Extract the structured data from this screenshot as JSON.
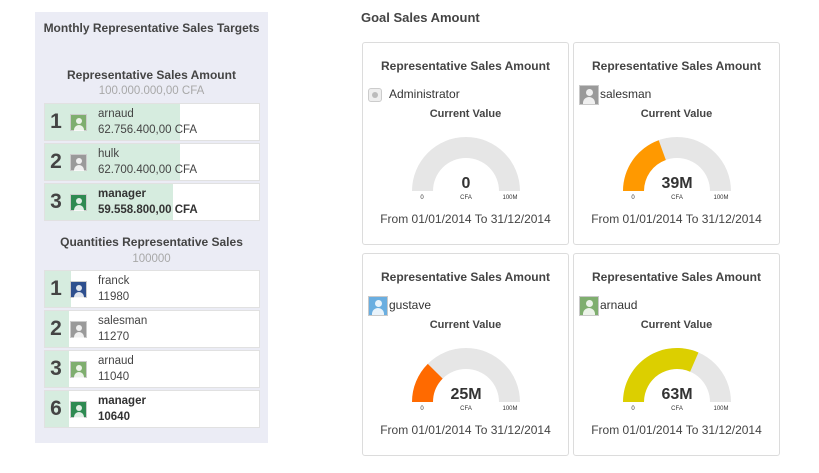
{
  "left_panel": {
    "title": "Monthly Representative Sales Targets",
    "amount_section": {
      "title": "Representative Sales Amount",
      "target": "100.000.000,00 CFA",
      "rows": [
        {
          "rank": "1",
          "name": "arnaud",
          "value": "62.756.400,00 CFA",
          "progress": 0.63,
          "avatar_color": "#7fae6f",
          "bold": false
        },
        {
          "rank": "2",
          "name": "hulk",
          "value": "62.700.400,00 CFA",
          "progress": 0.63,
          "avatar_color": "#9a9a9a",
          "bold": false
        },
        {
          "rank": "3",
          "name": "manager",
          "value": "59.558.800,00 CFA",
          "progress": 0.6,
          "avatar_color": "#2f8a52",
          "bold": true
        }
      ]
    },
    "quantity_section": {
      "title": "Quantities Representative Sales",
      "target": "100000",
      "rows": [
        {
          "rank": "1",
          "name": "franck",
          "value": "11980",
          "progress": 0.12,
          "avatar_color": "#2e4f8e",
          "bold": false
        },
        {
          "rank": "2",
          "name": "salesman",
          "value": "11270",
          "progress": 0.11,
          "avatar_color": "#9a9a9a",
          "bold": false
        },
        {
          "rank": "3",
          "name": "arnaud",
          "value": "11040",
          "progress": 0.11,
          "avatar_color": "#7fae6f",
          "bold": false
        },
        {
          "rank": "6",
          "name": "manager",
          "value": "10640",
          "progress": 0.11,
          "avatar_color": "#2f8a52",
          "bold": true
        }
      ]
    }
  },
  "goal": {
    "title": "Goal Sales Amount",
    "cards": [
      {
        "title": "Representative Sales Amount",
        "user": "Administrator",
        "user_icon": "admin-icon",
        "avatar_color": "#eeeeee",
        "current_label": "Current Value",
        "value_text": "0",
        "fraction": 0.0,
        "fill_color": "#ff9900",
        "min_label": "0",
        "max_label": "100M",
        "unit": "CFA",
        "range": "From 01/01/2014 To 31/12/2014"
      },
      {
        "title": "Representative Sales Amount",
        "user": "salesman",
        "user_icon": "user-avatar-icon",
        "avatar_color": "#9a9a9a",
        "current_label": "Current Value",
        "value_text": "39M",
        "fraction": 0.39,
        "fill_color": "#ff9900",
        "min_label": "0",
        "max_label": "100M",
        "unit": "CFA",
        "range": "From 01/01/2014 To 31/12/2014"
      },
      {
        "title": "Representative Sales Amount",
        "user": "gustave",
        "user_icon": "user-avatar-icon",
        "avatar_color": "#6aaee0",
        "current_label": "Current Value",
        "value_text": "25M",
        "fraction": 0.25,
        "fill_color": "#ff6a00",
        "min_label": "0",
        "max_label": "100M",
        "unit": "CFA",
        "range": "From 01/01/2014 To 31/12/2014"
      },
      {
        "title": "Representative Sales Amount",
        "user": "arnaud",
        "user_icon": "user-avatar-icon",
        "avatar_color": "#7fae6f",
        "current_label": "Current Value",
        "value_text": "63M",
        "fraction": 0.63,
        "fill_color": "#dccf00",
        "min_label": "0",
        "max_label": "100M",
        "unit": "CFA",
        "range": "From 01/01/2014 To 31/12/2014"
      }
    ]
  }
}
